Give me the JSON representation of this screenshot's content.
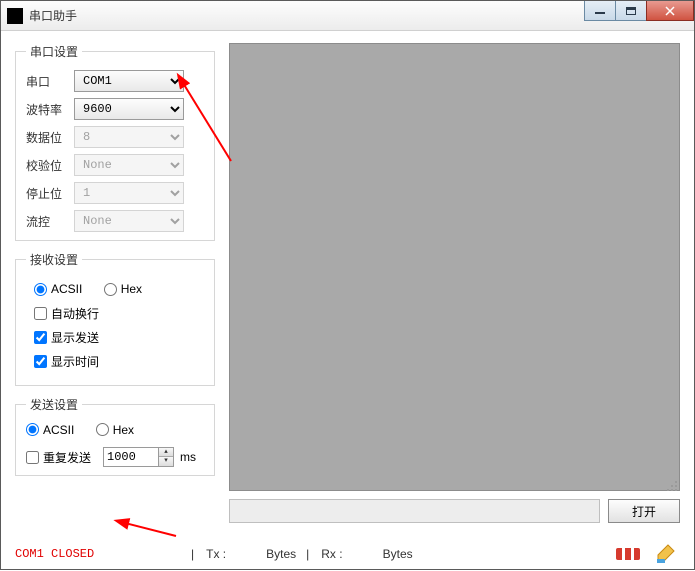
{
  "window": {
    "title": "串口助手"
  },
  "serial_group": {
    "legend": "串口设置",
    "port_label": "串口",
    "port_value": "COM1",
    "baud_label": "波特率",
    "baud_value": "9600",
    "data_label": "数据位",
    "data_value": "8",
    "parity_label": "校验位",
    "parity_value": "None",
    "stop_label": "停止位",
    "stop_value": "1",
    "flow_label": "流控",
    "flow_value": "None"
  },
  "recv_group": {
    "legend": "接收设置",
    "ascii_label": "ACSII",
    "hex_label": "Hex",
    "ascii_selected": true,
    "autowrap_label": "自动换行",
    "autowrap_checked": false,
    "showsend_label": "显示发送",
    "showsend_checked": true,
    "showtime_label": "显示时间",
    "showtime_checked": true
  },
  "send_group": {
    "legend": "发送设置",
    "ascii_label": "ACSII",
    "hex_label": "Hex",
    "ascii_selected": true,
    "repeat_label": "重复发送",
    "repeat_checked": false,
    "interval_value": "1000",
    "interval_unit": "ms"
  },
  "buttons": {
    "open": "打开"
  },
  "status": {
    "port_state": "COM1 CLOSED",
    "tx_label": "Tx :",
    "tx_unit": "Bytes",
    "rx_label": "Rx :",
    "rx_unit": "Bytes"
  }
}
